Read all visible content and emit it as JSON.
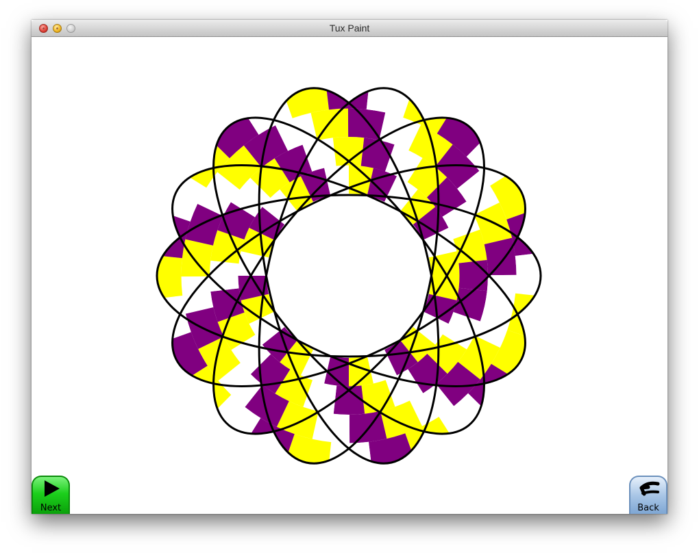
{
  "window": {
    "title": "Tux Paint"
  },
  "canvas": {
    "fill_colors": {
      "yellow": "#ffff00",
      "purple": "#800080",
      "white": "#ffffff",
      "stroke": "#000000"
    }
  },
  "buttons": {
    "next_label": "Next",
    "next_icon": "play-triangle-icon",
    "back_label": "Back",
    "back_icon": "back-arrow-icon"
  }
}
